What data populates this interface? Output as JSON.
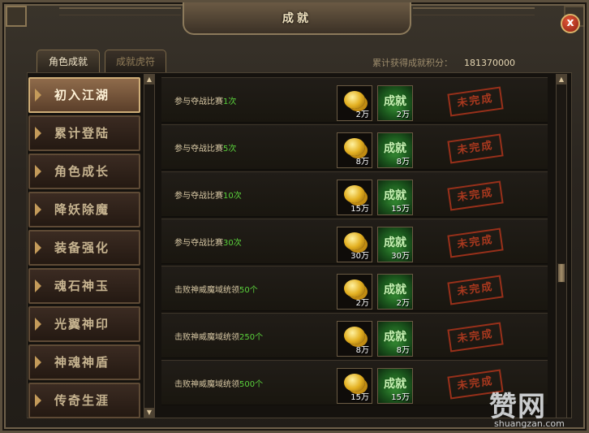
{
  "window": {
    "title": "成就",
    "close_label": "x"
  },
  "tabs": [
    {
      "label": "角色成就",
      "active": true
    },
    {
      "label": "成就虎符",
      "active": false
    }
  ],
  "score": {
    "label": "累计获得成就积分：",
    "value": "181370000"
  },
  "sidebar": {
    "items": [
      {
        "label": "初入江湖",
        "active": true
      },
      {
        "label": "累计登陆",
        "active": false
      },
      {
        "label": "角色成长",
        "active": false
      },
      {
        "label": "降妖除魔",
        "active": false
      },
      {
        "label": "装备强化",
        "active": false
      },
      {
        "label": "魂石神玉",
        "active": false
      },
      {
        "label": "光翼神印",
        "active": false
      },
      {
        "label": "神魂神盾",
        "active": false
      },
      {
        "label": "传奇生涯",
        "active": false
      }
    ]
  },
  "achievements": [
    {
      "text": "参与夺战比赛",
      "highlight": "1次",
      "coin_amount": "2万",
      "ach_label": "成就",
      "ach_amount": "2万",
      "status": "未完成"
    },
    {
      "text": "参与夺战比赛",
      "highlight": "5次",
      "coin_amount": "8万",
      "ach_label": "成就",
      "ach_amount": "8万",
      "status": "未完成"
    },
    {
      "text": "参与夺战比赛",
      "highlight": "10次",
      "coin_amount": "15万",
      "ach_label": "成就",
      "ach_amount": "15万",
      "status": "未完成"
    },
    {
      "text": "参与夺战比赛",
      "highlight": "30次",
      "coin_amount": "30万",
      "ach_label": "成就",
      "ach_amount": "30万",
      "status": "未完成"
    },
    {
      "text": "击败神威魔域统领",
      "highlight": "50个",
      "coin_amount": "2万",
      "ach_label": "成就",
      "ach_amount": "2万",
      "status": "未完成"
    },
    {
      "text": "击败神威魔域统领",
      "highlight": "250个",
      "coin_amount": "8万",
      "ach_label": "成就",
      "ach_amount": "8万",
      "status": "未完成"
    },
    {
      "text": "击败神威魔域统领",
      "highlight": "500个",
      "coin_amount": "15万",
      "ach_label": "成就",
      "ach_amount": "15万",
      "status": "未完成"
    }
  ],
  "scroll_arrows": {
    "up": "▲",
    "down": "▼"
  },
  "watermark": {
    "main": "赞网",
    "sub": "shuangzan.com"
  },
  "colors": {
    "highlight": "#5bd23c",
    "stamp": "#b83c20",
    "active_tab": "#8f6b4b"
  },
  "icons": [
    "close-icon",
    "gold-coin-icon",
    "achievement-icon",
    "triangle-marker-icon",
    "scroll-up-icon",
    "scroll-down-icon"
  ]
}
